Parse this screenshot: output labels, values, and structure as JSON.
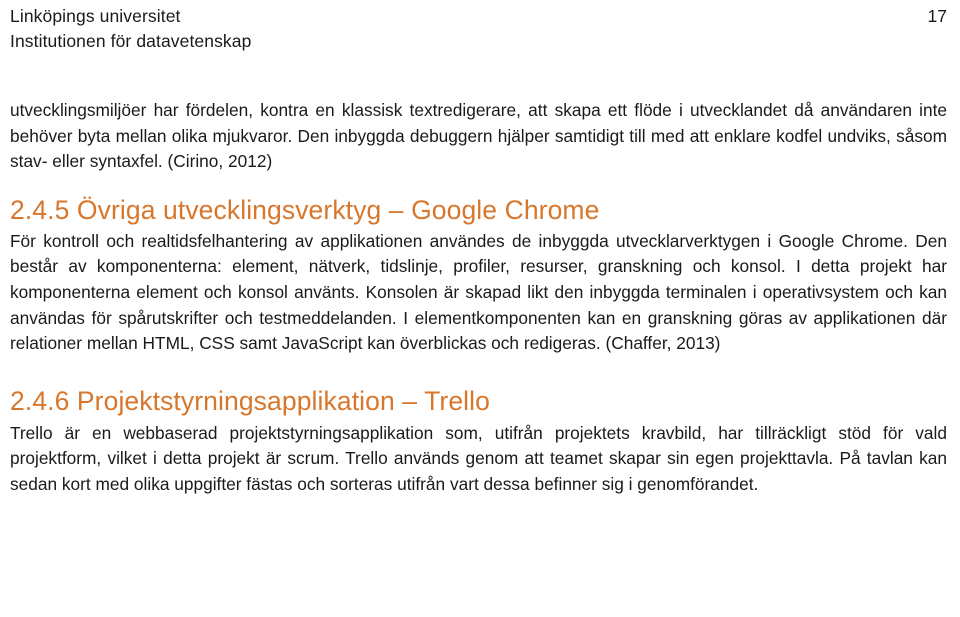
{
  "document": {
    "page_number": "17",
    "header": {
      "organization_line_1": "Linköpings universitet",
      "organization_line_2": "Institutionen för datavetenskap"
    },
    "accent_color": "#D8772B",
    "text_color": "#1a1a1a",
    "background_color": "#ffffff"
  },
  "content": {
    "paragraph_intro": "utvecklingsmiljöer har fördelen, kontra en klassisk textredigerare, att skapa ett flöde i utvecklandet då användaren inte behöver byta mellan olika mjukvaror. Den inbyggda debuggern hjälper samtidigt till med att enklare kodfel undviks, såsom stav- eller syntaxfel. (Cirino, 2012)",
    "section_245": {
      "number": "2.4.5",
      "title": "Övriga utvecklingsverktyg – Google Chrome",
      "full_heading": "2.4.5 Övriga utvecklingsverktyg – Google Chrome",
      "body": "För kontroll och realtidsfelhantering av applikationen användes de inbyggda utvecklarverktygen i Google Chrome.  Den består av komponenterna: element, nätverk, tidslinje, profiler, resurser, granskning och konsol. I detta projekt har komponenterna element och konsol använts. Konsolen är skapad likt den inbyggda terminalen i operativsystem och kan användas för spårutskrifter och testmeddelanden. I elementkomponenten kan en granskning göras av applikationen där relationer mellan HTML, CSS samt JavaScript kan överblickas och redigeras. (Chaffer, 2013)"
    },
    "section_246": {
      "number": "2.4.6",
      "title": "Projektstyrningsapplikation – Trello",
      "full_heading": "2.4.6 Projektstyrningsapplikation – Trello",
      "body": "Trello är en webbaserad projektstyrningsapplikation som, utifrån projektets kravbild, har tillräckligt stöd för vald projektform, vilket i detta projekt är scrum. Trello används genom att teamet skapar sin egen projekttavla. På tavlan kan sedan kort med olika uppgifter fästas och sorteras utifrån vart dessa befinner sig i genomförandet."
    }
  }
}
